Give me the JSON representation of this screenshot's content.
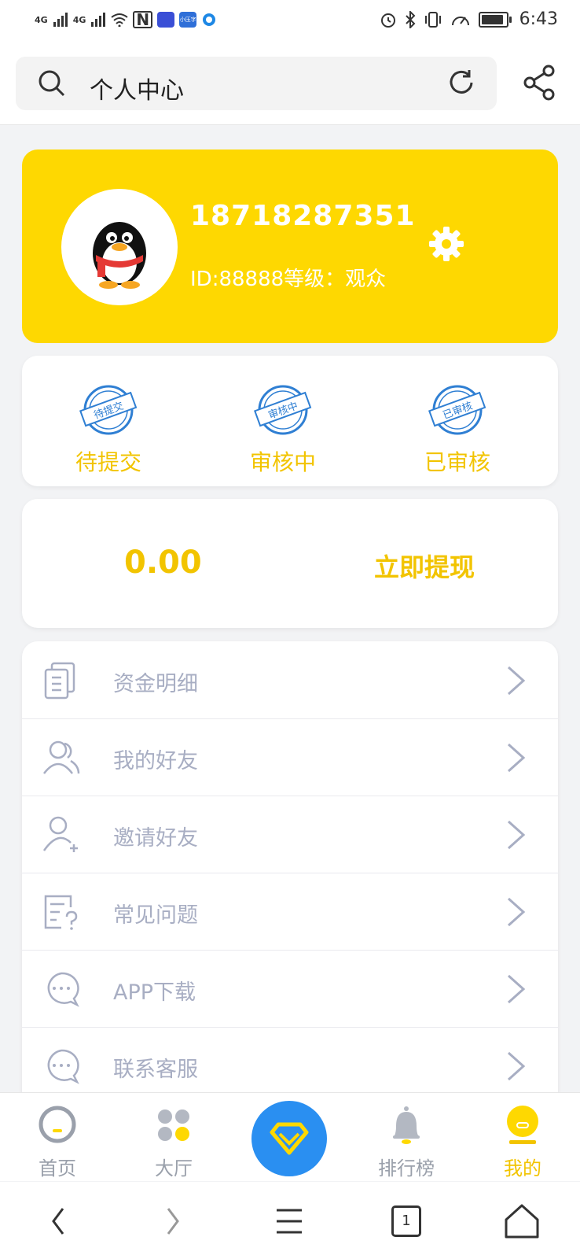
{
  "status_bar": {
    "signal1": "4G",
    "signal2": "4G",
    "nfc": "N",
    "app1": "",
    "app2": "小压字",
    "time": "6:43"
  },
  "search": {
    "title": "个人中心"
  },
  "profile": {
    "phone": "18718287351",
    "id_level": "ID:88888等级：观众"
  },
  "review_status": [
    {
      "label": "待提交",
      "stamp": "待提交"
    },
    {
      "label": "审核中",
      "stamp": "审核中"
    },
    {
      "label": "已审核",
      "stamp": "已审核"
    }
  ],
  "balance": {
    "amount": "0.00",
    "withdraw_label": "立即提现"
  },
  "menu": [
    {
      "label": "资金明细",
      "icon": "wallet-detail-icon"
    },
    {
      "label": "我的好友",
      "icon": "friends-icon"
    },
    {
      "label": "邀请好友",
      "icon": "invite-user-icon"
    },
    {
      "label": "常见问题",
      "icon": "faq-icon"
    },
    {
      "label": "APP下载",
      "icon": "chat-bubble-icon"
    },
    {
      "label": "联系客服",
      "icon": "chat-bubble-icon"
    }
  ],
  "tabs": [
    {
      "label": "首页",
      "icon": "home-chat-icon",
      "active": false
    },
    {
      "label": "大厅",
      "icon": "grid-icon",
      "active": false
    },
    {
      "label": "",
      "icon": "diamond-icon",
      "active": false
    },
    {
      "label": "排行榜",
      "icon": "bell-icon",
      "active": false
    },
    {
      "label": "我的",
      "icon": "user-icon",
      "active": true
    }
  ],
  "system_nav": {
    "tab_count": "1"
  },
  "colors": {
    "accent": "#fed801",
    "accent_text": "#f2c400",
    "center_button": "#2a8ff1",
    "menu_text": "#a8aec3"
  }
}
